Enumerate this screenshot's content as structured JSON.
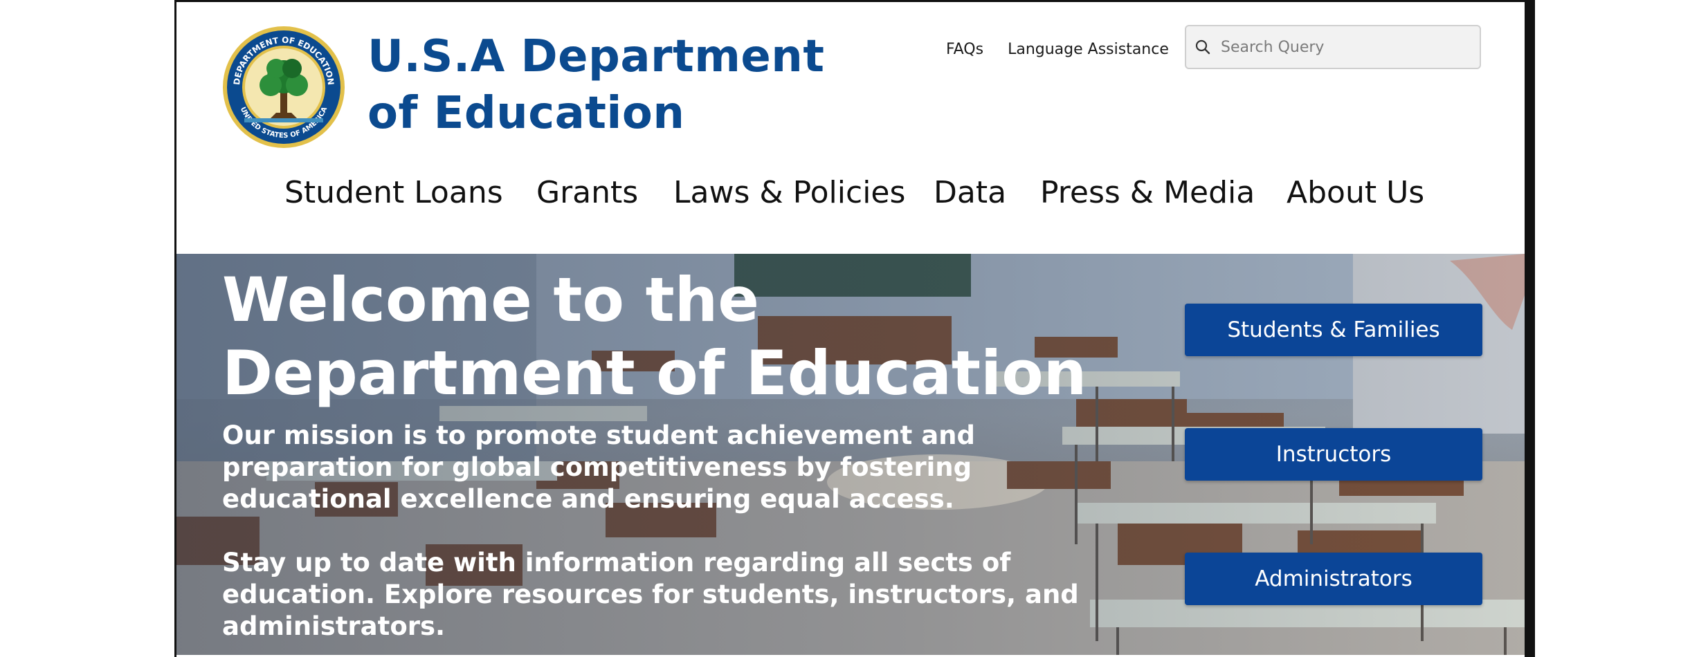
{
  "header": {
    "brand_line1": "U.S.A Department",
    "brand_line2": "of Education",
    "seal_text_top": "DEPARTMENT OF EDUCATION",
    "seal_text_bottom": "UNITED STATES OF AMERICA",
    "links": {
      "faqs": "FAQs",
      "language": "Language Assistance"
    },
    "search": {
      "placeholder": "Search Query",
      "value": ""
    }
  },
  "nav": {
    "student_loans": "Student Loans",
    "grants": "Grants",
    "laws_policies": "Laws & Policies",
    "data": "Data",
    "press_media": "Press & Media",
    "about_us": "About Us"
  },
  "hero": {
    "title_line1": "Welcome to the",
    "title_line2": "Department of Education",
    "mission": "Our mission is to promote student achievement and preparation for global competitiveness by fostering educational excellence and ensuring equal access.",
    "stay": "Stay up to date with information regarding all sects of education. Explore resources for students, instructors, and administrators.",
    "buttons": {
      "students_families": "Students & Families",
      "instructors": "Instructors",
      "administrators": "Administrators"
    }
  },
  "colors": {
    "brand_blue": "#0b4a8f",
    "button_blue": "#0b4597"
  },
  "icons": {
    "search": "search-icon",
    "seal": "seal-logo"
  }
}
